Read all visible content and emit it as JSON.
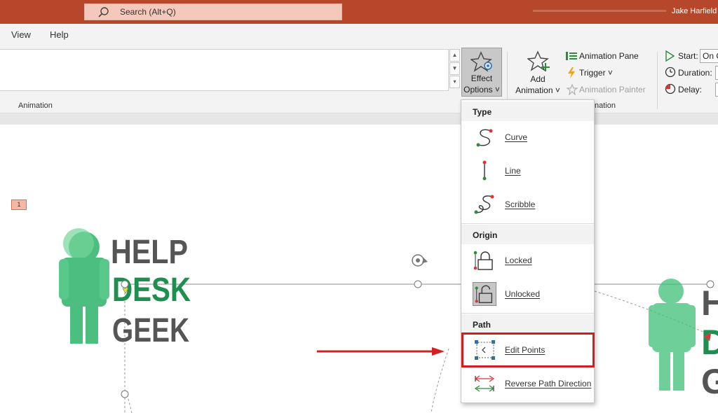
{
  "titlebar": {
    "search_placeholder": "Search (Alt+Q)",
    "user_name": "Jake Harfield"
  },
  "menu": {
    "tabs": [
      "View",
      "Help"
    ]
  },
  "ribbon": {
    "group_animation": "Animation",
    "group_advanced_partial": "nation",
    "effect_options": {
      "line1": "Effect",
      "line2": "Options ˅"
    },
    "add_animation": {
      "line1": "Add",
      "line2": "Animation ˅"
    },
    "animation_pane": "Animation Pane",
    "trigger": "Trigger ˅",
    "animation_painter": "Animation Painter",
    "timing": {
      "start_label": "Start:",
      "start_value": "On C",
      "duration_label": "Duration:",
      "delay_label": "Delay:"
    }
  },
  "slide": {
    "animation_tag": "1",
    "logo_lines": [
      "HELP",
      "DESK",
      "GEEK"
    ]
  },
  "dropdown": {
    "type_header": "Type",
    "type_items": [
      "Curve",
      "Line",
      "Scribble"
    ],
    "origin_header": "Origin",
    "origin_items": [
      "Locked",
      "Unlocked"
    ],
    "path_header": "Path",
    "path_items": [
      "Edit Points",
      "Reverse Path Direction"
    ]
  },
  "colors": {
    "titlebar": "#b7472a",
    "highlight": "#cc1f1f",
    "logo_green": "#2db36a"
  }
}
